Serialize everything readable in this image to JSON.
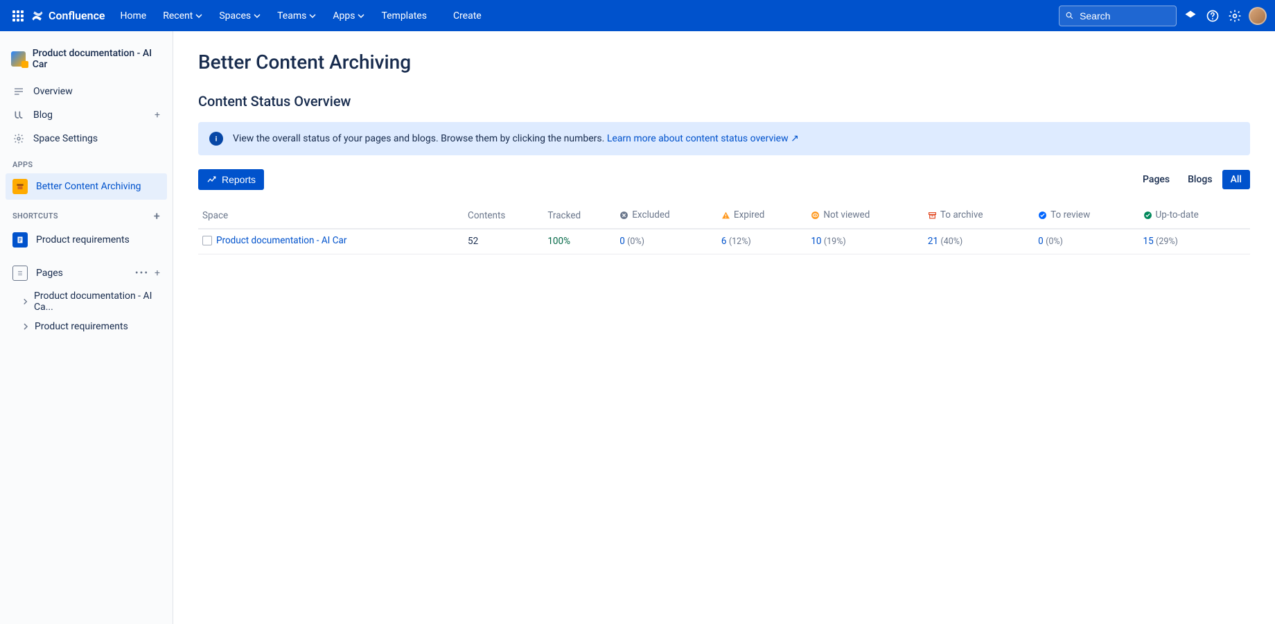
{
  "nav": {
    "product": "Confluence",
    "items": [
      "Home",
      "Recent",
      "Spaces",
      "Teams",
      "Apps",
      "Templates",
      "Create"
    ],
    "search_placeholder": "Search"
  },
  "sidebar": {
    "space_name": "Product documentation - AI Car",
    "overview": "Overview",
    "blog": "Blog",
    "space_settings": "Space Settings",
    "section_apps": "APPS",
    "app_better": "Better Content Archiving",
    "section_shortcuts": "SHORTCUTS",
    "shortcut_1": "Product requirements",
    "pages_label": "Pages",
    "tree": [
      "Product documentation - AI Ca...",
      "Product requirements"
    ]
  },
  "main": {
    "title": "Better Content Archiving",
    "subtitle": "Content Status Overview",
    "banner_text": "View the overall status of your pages and blogs. Browse them by clicking the numbers. ",
    "banner_link": "Learn more about content status overview",
    "reports_btn": "Reports",
    "filters": {
      "pages": "Pages",
      "blogs": "Blogs",
      "all": "All"
    },
    "columns": {
      "space": "Space",
      "contents": "Contents",
      "tracked": "Tracked",
      "excluded": "Excluded",
      "expired": "Expired",
      "not_viewed": "Not viewed",
      "to_archive": "To archive",
      "to_review": "To review",
      "up_to_date": "Up-to-date"
    },
    "row": {
      "space": "Product documentation - AI Car",
      "contents": "52",
      "tracked": "100%",
      "excluded": {
        "n": "0",
        "p": "(0%)"
      },
      "expired": {
        "n": "6",
        "p": "(12%)"
      },
      "not_viewed": {
        "n": "10",
        "p": "(19%)"
      },
      "to_archive": {
        "n": "21",
        "p": "(40%)"
      },
      "to_review": {
        "n": "0",
        "p": "(0%)"
      },
      "up_to_date": {
        "n": "15",
        "p": "(29%)"
      }
    }
  }
}
